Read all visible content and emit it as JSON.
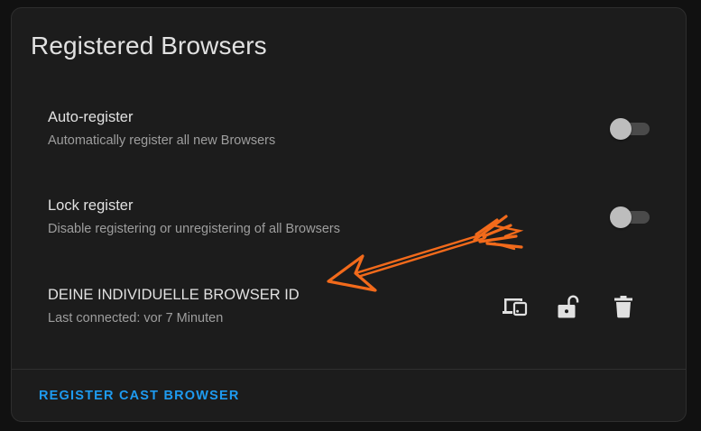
{
  "card": {
    "title": "Registered Browsers"
  },
  "settings": [
    {
      "label": "Auto-register",
      "description": "Automatically register all new Browsers",
      "enabled": false
    },
    {
      "label": "Lock register",
      "description": "Disable registering or unregistering of all Browsers",
      "enabled": false
    }
  ],
  "browser": {
    "id": "DEINE INDIVIDUELLE BROWSER ID",
    "last_connected": "Last connected: vor 7 Minuten",
    "actions": [
      {
        "icon": "devices-icon",
        "action": "browser-settings"
      },
      {
        "icon": "lock-open-icon",
        "action": "lock-browser"
      },
      {
        "icon": "trash-icon",
        "action": "delete-browser"
      }
    ]
  },
  "footer": {
    "action_label": "REGISTER CAST BROWSER"
  },
  "annotation": {
    "icon": "orange-arrow-icon",
    "color": "#f26a1b"
  },
  "colors": {
    "background": "#111111",
    "card": "#1c1c1c",
    "primary_text": "#e1e1e1",
    "secondary_text": "#9e9e9e",
    "accent": "#1e9bf0",
    "toggle_off_thumb": "#bdbdbd",
    "toggle_off_track": "#4a4a4a"
  }
}
